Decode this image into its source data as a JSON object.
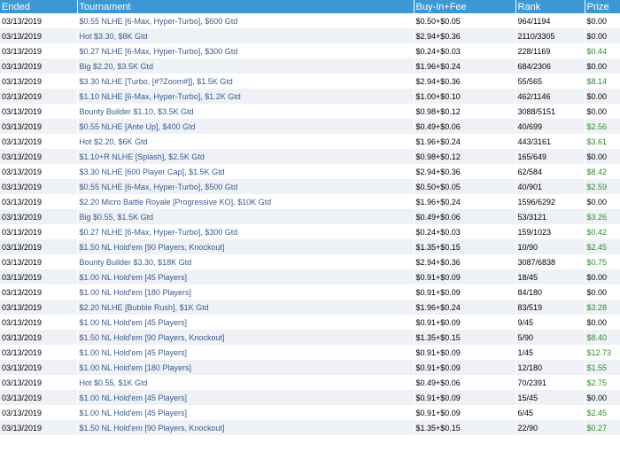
{
  "columns": {
    "ended": "Ended",
    "tournament": "Tournament",
    "buyin": "Buy-In+Fee",
    "rank": "Rank",
    "prize": "Prize"
  },
  "colors": {
    "header": "#3c98d4",
    "row_alt": "#eef1f6",
    "link": "#3a5a8c",
    "win": "#2e8b2e"
  },
  "rows": [
    {
      "ended": "03/13/2019",
      "tournament": "$0.55 NLHE [6-Max, Hyper-Turbo], $600 Gtd",
      "buyin": "$0.50+$0.05",
      "rank": "964/1194",
      "prize": "$0.00",
      "win": false
    },
    {
      "ended": "03/13/2019",
      "tournament": "Hot $3.30, $8K Gtd",
      "buyin": "$2.94+$0.36",
      "rank": "2110/3305",
      "prize": "$0.00",
      "win": false
    },
    {
      "ended": "03/13/2019",
      "tournament": "$0.27 NLHE [6-Max, Hyper-Turbo], $300 Gtd",
      "buyin": "$0.24+$0.03",
      "rank": "228/1169",
      "prize": "$0.44",
      "win": true
    },
    {
      "ended": "03/13/2019",
      "tournament": "Big $2.20, $3.5K Gtd",
      "buyin": "$1.96+$0.24",
      "rank": "684/2306",
      "prize": "$0.00",
      "win": false
    },
    {
      "ended": "03/13/2019",
      "tournament": "$3.30 NLHE [Turbo, [#?Zoom#]], $1.5K Gtd",
      "buyin": "$2.94+$0.36",
      "rank": "55/565",
      "prize": "$8.14",
      "win": true
    },
    {
      "ended": "03/13/2019",
      "tournament": "$1.10 NLHE [6-Max, Hyper-Turbo], $1.2K Gtd",
      "buyin": "$1.00+$0.10",
      "rank": "462/1146",
      "prize": "$0.00",
      "win": false
    },
    {
      "ended": "03/13/2019",
      "tournament": "Bounty Builder $1.10, $3.5K Gtd",
      "buyin": "$0.98+$0.12",
      "rank": "3088/5151",
      "prize": "$0.00",
      "win": false
    },
    {
      "ended": "03/13/2019",
      "tournament": "$0.55 NLHE [Ante Up], $400 Gtd",
      "buyin": "$0.49+$0.06",
      "rank": "40/699",
      "prize": "$2.56",
      "win": true
    },
    {
      "ended": "03/13/2019",
      "tournament": "Hot $2.20, $6K Gtd",
      "buyin": "$1.96+$0.24",
      "rank": "443/3161",
      "prize": "$3.61",
      "win": true
    },
    {
      "ended": "03/13/2019",
      "tournament": "$1.10+R NLHE [Splash], $2.5K Gtd",
      "buyin": "$0.98+$0.12",
      "rank": "165/649",
      "prize": "$0.00",
      "win": false
    },
    {
      "ended": "03/13/2019",
      "tournament": "$3.30 NLHE [600 Player Cap], $1.5K Gtd",
      "buyin": "$2.94+$0.36",
      "rank": "62/584",
      "prize": "$8.42",
      "win": true
    },
    {
      "ended": "03/13/2019",
      "tournament": "$0.55 NLHE [6-Max, Hyper-Turbo], $500 Gtd",
      "buyin": "$0.50+$0.05",
      "rank": "40/901",
      "prize": "$2.59",
      "win": true
    },
    {
      "ended": "03/13/2019",
      "tournament": "$2.20 Micro Battle Royale [Progressive KO], $10K Gtd",
      "buyin": "$1.96+$0.24",
      "rank": "1596/6292",
      "prize": "$0.00",
      "win": false
    },
    {
      "ended": "03/13/2019",
      "tournament": "Big $0.55, $1.5K Gtd",
      "buyin": "$0.49+$0.06",
      "rank": "53/3121",
      "prize": "$3.26",
      "win": true
    },
    {
      "ended": "03/13/2019",
      "tournament": "$0.27 NLHE [6-Max, Hyper-Turbo], $300 Gtd",
      "buyin": "$0.24+$0.03",
      "rank": "159/1023",
      "prize": "$0.42",
      "win": true
    },
    {
      "ended": "03/13/2019",
      "tournament": "$1.50 NL Hold'em [90 Players, Knockout]",
      "buyin": "$1.35+$0.15",
      "rank": "10/90",
      "prize": "$2.45",
      "win": true
    },
    {
      "ended": "03/13/2019",
      "tournament": "Bounty Builder $3.30, $18K Gtd",
      "buyin": "$2.94+$0.36",
      "rank": "3087/6838",
      "prize": "$0.75",
      "win": true
    },
    {
      "ended": "03/13/2019",
      "tournament": "$1.00 NL Hold'em [45 Players]",
      "buyin": "$0.91+$0.09",
      "rank": "18/45",
      "prize": "$0.00",
      "win": false
    },
    {
      "ended": "03/13/2019",
      "tournament": "$1.00 NL Hold'em [180 Players]",
      "buyin": "$0.91+$0.09",
      "rank": "84/180",
      "prize": "$0.00",
      "win": false
    },
    {
      "ended": "03/13/2019",
      "tournament": "$2.20 NLHE [Bubble Rush], $1K Gtd",
      "buyin": "$1.96+$0.24",
      "rank": "83/519",
      "prize": "$3.28",
      "win": true
    },
    {
      "ended": "03/13/2019",
      "tournament": "$1.00 NL Hold'em [45 Players]",
      "buyin": "$0.91+$0.09",
      "rank": "9/45",
      "prize": "$0.00",
      "win": false
    },
    {
      "ended": "03/13/2019",
      "tournament": "$1.50 NL Hold'em [90 Players, Knockout]",
      "buyin": "$1.35+$0.15",
      "rank": "5/90",
      "prize": "$8.40",
      "win": true
    },
    {
      "ended": "03/13/2019",
      "tournament": "$1.00 NL Hold'em [45 Players]",
      "buyin": "$0.91+$0.09",
      "rank": "1/45",
      "prize": "$12.73",
      "win": true
    },
    {
      "ended": "03/13/2019",
      "tournament": "$1.00 NL Hold'em [180 Players]",
      "buyin": "$0.91+$0.09",
      "rank": "12/180",
      "prize": "$1.55",
      "win": true
    },
    {
      "ended": "03/13/2019",
      "tournament": "Hot $0.55, $1K Gtd",
      "buyin": "$0.49+$0.06",
      "rank": "70/2391",
      "prize": "$2.75",
      "win": true
    },
    {
      "ended": "03/13/2019",
      "tournament": "$1.00 NL Hold'em [45 Players]",
      "buyin": "$0.91+$0.09",
      "rank": "15/45",
      "prize": "$0.00",
      "win": false
    },
    {
      "ended": "03/13/2019",
      "tournament": "$1.00 NL Hold'em [45 Players]",
      "buyin": "$0.91+$0.09",
      "rank": "6/45",
      "prize": "$2.45",
      "win": true
    },
    {
      "ended": "03/13/2019",
      "tournament": "$1.50 NL Hold'em [90 Players, Knockout]",
      "buyin": "$1.35+$0.15",
      "rank": "22/90",
      "prize": "$0.27",
      "win": true
    }
  ]
}
